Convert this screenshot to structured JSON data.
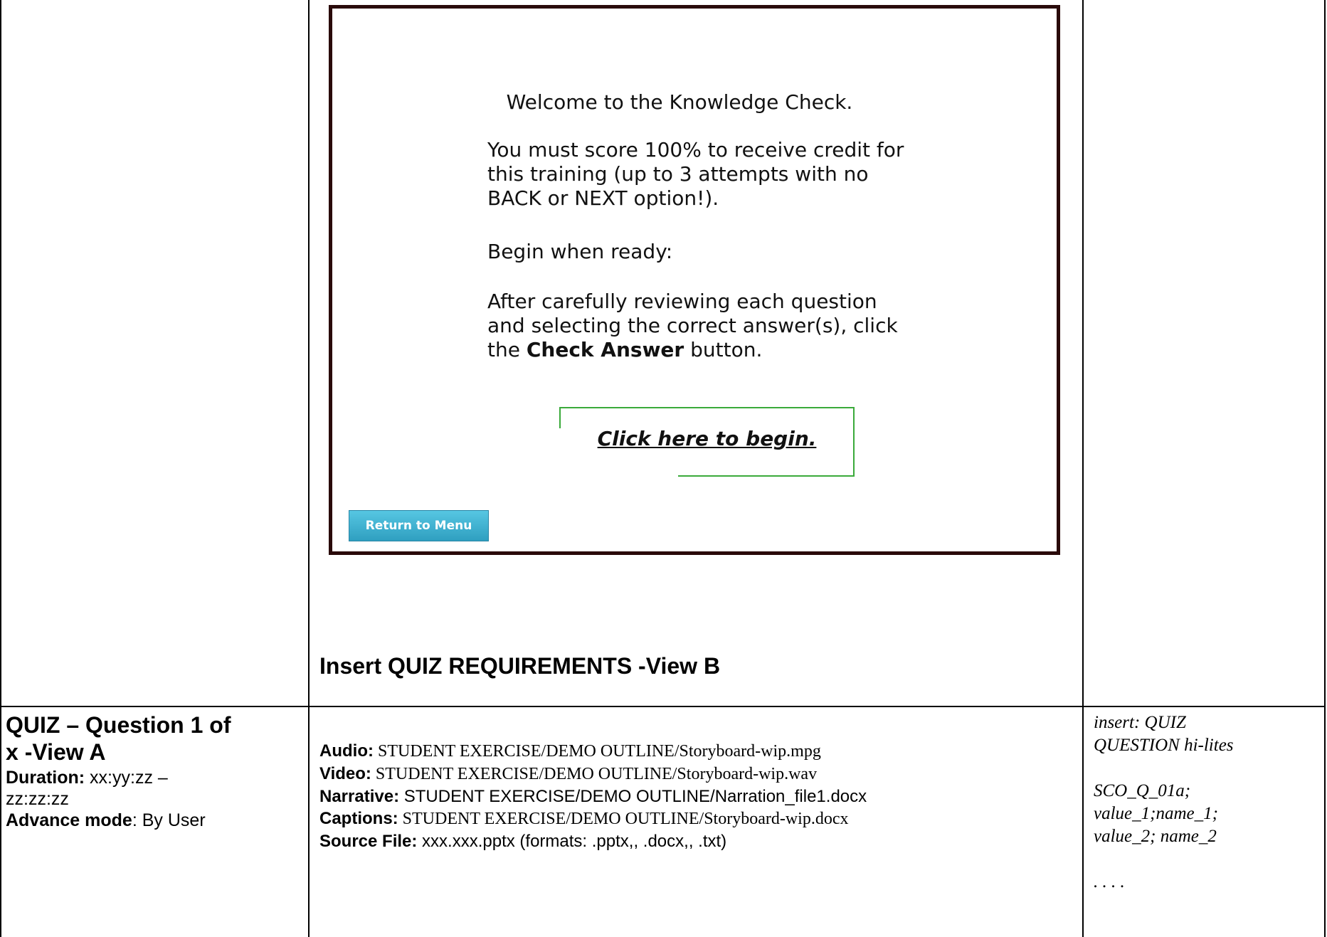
{
  "slide": {
    "title": "Welcome to the Knowledge Check.",
    "para1": [
      "You must score 100% to receive credit for",
      "this training (up to 3 attempts with no",
      "BACK or NEXT option!)."
    ],
    "para2": "Begin when ready:",
    "para3_line1": "After carefully reviewing each question",
    "para3_line2": "and selecting the correct answer(s), click",
    "para3_line3_pre": "the ",
    "para3_line3_bold": "Check Answer",
    "para3_line3_post": " button.",
    "begin_link": "Click here to begin.",
    "return_button": "Return to Menu",
    "accent_green": "#3aaa3a",
    "button_color": "#3fb3d4"
  },
  "view_b": "Insert QUIZ REQUIREMENTS -View B",
  "quiz": {
    "title_line1": "QUIZ – Question 1 of",
    "title_line2": "x -View A",
    "duration_label": "Duration:",
    "duration_value1": " xx:yy:zz –",
    "duration_value2": "zz:zz:zz",
    "advance_label": "Advance mode",
    "advance_value": ": By User"
  },
  "files": {
    "audio_label": "Audio:",
    "audio_value": " STUDENT EXERCISE/DEMO OUTLINE/Storyboard-wip.mpg",
    "video_label": "Video:",
    "video_value": " STUDENT EXERCISE/DEMO OUTLINE/Storyboard-wip.wav",
    "narrative_label": "Narrative:",
    "narrative_value": " STUDENT EXERCISE/DEMO OUTLINE/Narration_file1.docx",
    "captions_label": "Captions:",
    "captions_value": " STUDENT EXERCISE/DEMO OUTLINE/Storyboard-wip.docx",
    "source_label": "Source File:",
    "source_value": " xxx.xxx.pptx  (formats: .pptx,, .docx,, .txt)"
  },
  "notes": {
    "line1": "insert: QUIZ",
    "line2": "QUESTION hi-lites",
    "line3": "SCO_Q_01a;",
    "line4": "value_1;name_1;",
    "line5": "value_2; name_2",
    "line6": ". . . ."
  }
}
